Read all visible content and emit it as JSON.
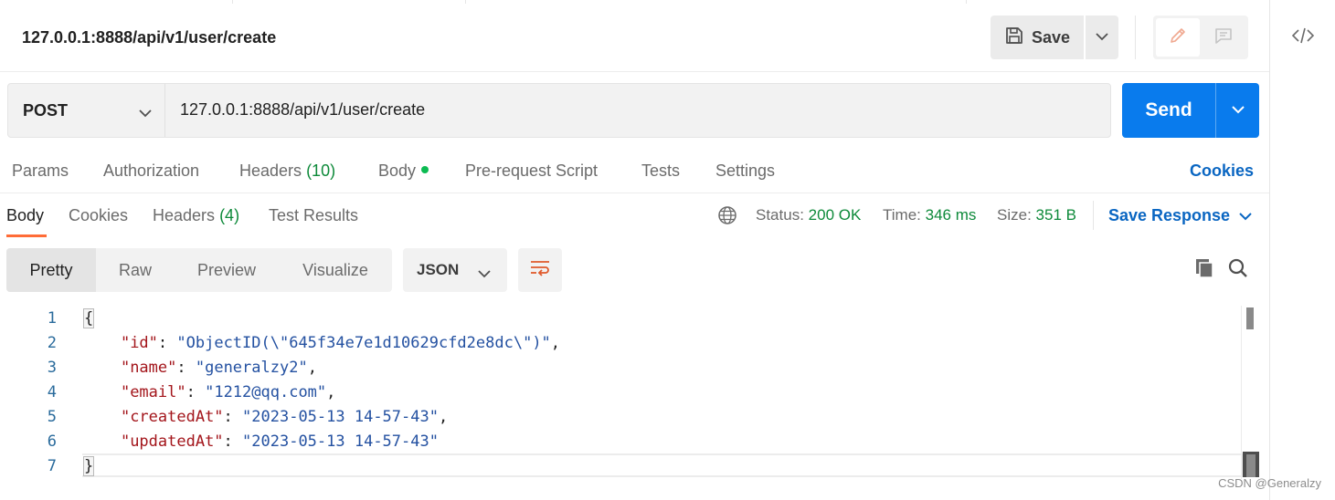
{
  "header": {
    "title": "127.0.0.1:8888/api/v1/user/create",
    "save_label": "Save"
  },
  "request": {
    "method": "POST",
    "url": "127.0.0.1:8888/api/v1/user/create",
    "send_label": "Send"
  },
  "request_tabs": {
    "params": "Params",
    "authorization": "Authorization",
    "headers": "Headers",
    "headers_count": "(10)",
    "body": "Body",
    "prerequest": "Pre-request Script",
    "tests": "Tests",
    "settings": "Settings",
    "cookies": "Cookies"
  },
  "response_tabs": {
    "body": "Body",
    "cookies": "Cookies",
    "headers": "Headers",
    "headers_count": "(4)",
    "test_results": "Test Results"
  },
  "response_meta": {
    "status_label": "Status:",
    "status_value": "200 OK",
    "time_label": "Time:",
    "time_value": "346 ms",
    "size_label": "Size:",
    "size_value": "351 B",
    "save_response": "Save Response"
  },
  "view": {
    "pretty": "Pretty",
    "raw": "Raw",
    "preview": "Preview",
    "visualize": "Visualize",
    "format": "JSON"
  },
  "code": {
    "line_numbers": [
      "1",
      "2",
      "3",
      "4",
      "5",
      "6",
      "7"
    ],
    "open_brace": "{",
    "close_brace": "}",
    "fields": [
      {
        "key": "\"id\"",
        "value": "\"ObjectID(\\\"645f34e7e1d10629cfd2e8dc\\\")\"",
        "comma": ","
      },
      {
        "key": "\"name\"",
        "value": "\"generalzy2\"",
        "comma": ","
      },
      {
        "key": "\"email\"",
        "value": "\"1212@qq.com\"",
        "comma": ","
      },
      {
        "key": "\"createdAt\"",
        "value": "\"2023-05-13 14-57-43\"",
        "comma": ","
      },
      {
        "key": "\"updatedAt\"",
        "value": "\"2023-05-13 14-57-43\"",
        "comma": ""
      }
    ]
  },
  "watermark": "CSDN @Generalzy",
  "colors": {
    "accent_blue": "#097bed",
    "link_blue": "#0a66c2",
    "status_green": "#0e8a3a",
    "active_orange": "#ff6c37",
    "json_key": "#a3151b",
    "json_string": "#2451a1"
  }
}
